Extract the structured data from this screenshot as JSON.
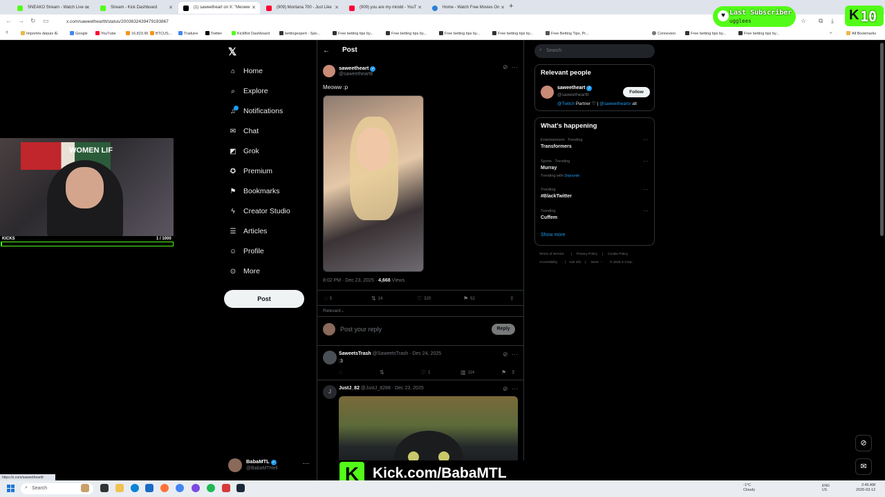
{
  "browser": {
    "tabs": [
      {
        "title": "SNEAKO Stream - Watch Live o",
        "color": "#53fc18"
      },
      {
        "title": "Stream - Kick Dashboard",
        "color": "#53fc18"
      },
      {
        "title": "(1) saweetheart on X: \"Meoww",
        "color": "#000000"
      },
      {
        "title": "(909) Montana 700 - Just Like",
        "color": "#ff0033"
      },
      {
        "title": "(909) you are my mindd - YouT",
        "color": "#ff0033"
      },
      {
        "title": "Home - Watch Free Movies On",
        "color": "#2b7fd6"
      }
    ],
    "url": "x.com/saweethearttt/status/2003632439479193867",
    "bookmarks": [
      "Importés depuis IE",
      "Google",
      "YouTube",
      "16,823.96",
      "BTCUS...",
      "Traduire",
      "Twitter",
      "KickBot Dashboard",
      "bettingexpert - Spo...",
      "Free betting tips by...",
      "Free betting tips by...",
      "Free betting tips by...",
      "Free betting tips by...",
      "Free Betting Tips, Pr...",
      "Connexion",
      "Free betting tips by...",
      "Free betting tips by..."
    ],
    "all_bookmarks": "All Bookmarks"
  },
  "sidebar": {
    "items": [
      {
        "label": "Home",
        "icon": "home-icon",
        "glyph": "⌂"
      },
      {
        "label": "Explore",
        "icon": "search-icon",
        "glyph": "⌕"
      },
      {
        "label": "Notifications",
        "icon": "bell-icon",
        "glyph": "🔔"
      },
      {
        "label": "Chat",
        "icon": "mail-icon",
        "glyph": "✉"
      },
      {
        "label": "Grok",
        "icon": "grok-icon",
        "glyph": "◩"
      },
      {
        "label": "Premium",
        "icon": "verified-icon",
        "glyph": "✪"
      },
      {
        "label": "Bookmarks",
        "icon": "bookmark-icon",
        "glyph": "🔖"
      },
      {
        "label": "Creator Studio",
        "icon": "bolt-icon",
        "glyph": "⚡"
      },
      {
        "label": "Articles",
        "icon": "articles-icon",
        "glyph": "☰"
      },
      {
        "label": "Profile",
        "icon": "person-icon",
        "glyph": "👤"
      },
      {
        "label": "More",
        "icon": "more-icon",
        "glyph": "⋯"
      }
    ],
    "post_button": "Post",
    "account": {
      "name": "BabaMTL",
      "handle": "@BabaMTHell"
    }
  },
  "post": {
    "header": "Post",
    "author": {
      "name": "saweetheart",
      "handle": "@saweethearttt"
    },
    "text": "Meoww :p",
    "time": "8:02 PM · Dec 23, 2025",
    "views_count": "4,668",
    "views_label": "Views",
    "actions": {
      "replies": "5",
      "reposts": "14",
      "likes": "320",
      "bookmarks": "52"
    },
    "sort_label": "Relevant",
    "reply_placeholder": "Post your reply",
    "reply_button": "Reply"
  },
  "replies": [
    {
      "name": "SaweetsTrash",
      "handle": "@SaweetsTrash",
      "date": "Dec 24, 2025",
      "text": ":3",
      "likes": "1",
      "views": "114"
    },
    {
      "name": "JustJ_82",
      "handle": "@JustJ_8288",
      "date": "Dec 23, 2025"
    }
  ],
  "right": {
    "search_placeholder": "Search",
    "relevant": {
      "title": "Relevant people",
      "name": "saweetheart",
      "handle": "@saweethearttt",
      "follow": "Follow",
      "bio_link1": "@Twitch",
      "bio_mid": "Partner ♡ |",
      "bio_link2": "@saweetheartx",
      "bio_end": "alt"
    },
    "happening": {
      "title": "What's happening",
      "trends": [
        {
          "meta": "Entertainment · Trending",
          "name": "Transformers",
          "extra": ""
        },
        {
          "meta": "Sports · Trending",
          "name": "Murray",
          "extra_prefix": "Trending with",
          "extra": "Dejounte"
        },
        {
          "meta": "Trending",
          "name": "#BlackTwitter",
          "extra": ""
        },
        {
          "meta": "Trending",
          "name": "Cuffem",
          "extra": ""
        }
      ],
      "show_more": "Show more"
    },
    "footer": [
      "Terms of Service",
      "|",
      "Privacy Policy",
      "|",
      "Cookie Policy",
      "Accessibility",
      "|",
      "Ads info",
      "|",
      "More ···",
      "© 2026 X Corp."
    ]
  },
  "overlay": {
    "webcam_flag_text": "WOMEN LIF",
    "kicks_label": "KICKS",
    "kicks_count": "1 / 1000",
    "kicks_progress": 0.001,
    "last_subscriber_title": "Last Subscriber",
    "last_subscriber_name": "ugglees",
    "sub_counter": "10",
    "kick_url": "Kick.com/BabaMTL",
    "status_url": "https://x.com/saweethearttt"
  },
  "taskbar": {
    "search": "Search",
    "weather_temp": "-1°C",
    "weather_desc": "Cloudy",
    "lang_line1": "ENG",
    "lang_line2": "US",
    "time": "2:46 AM",
    "date": "2026-03-12"
  },
  "colors": {
    "kick_green": "#53fc18",
    "x_blue": "#1d9bf0",
    "x_bg": "#000000"
  }
}
